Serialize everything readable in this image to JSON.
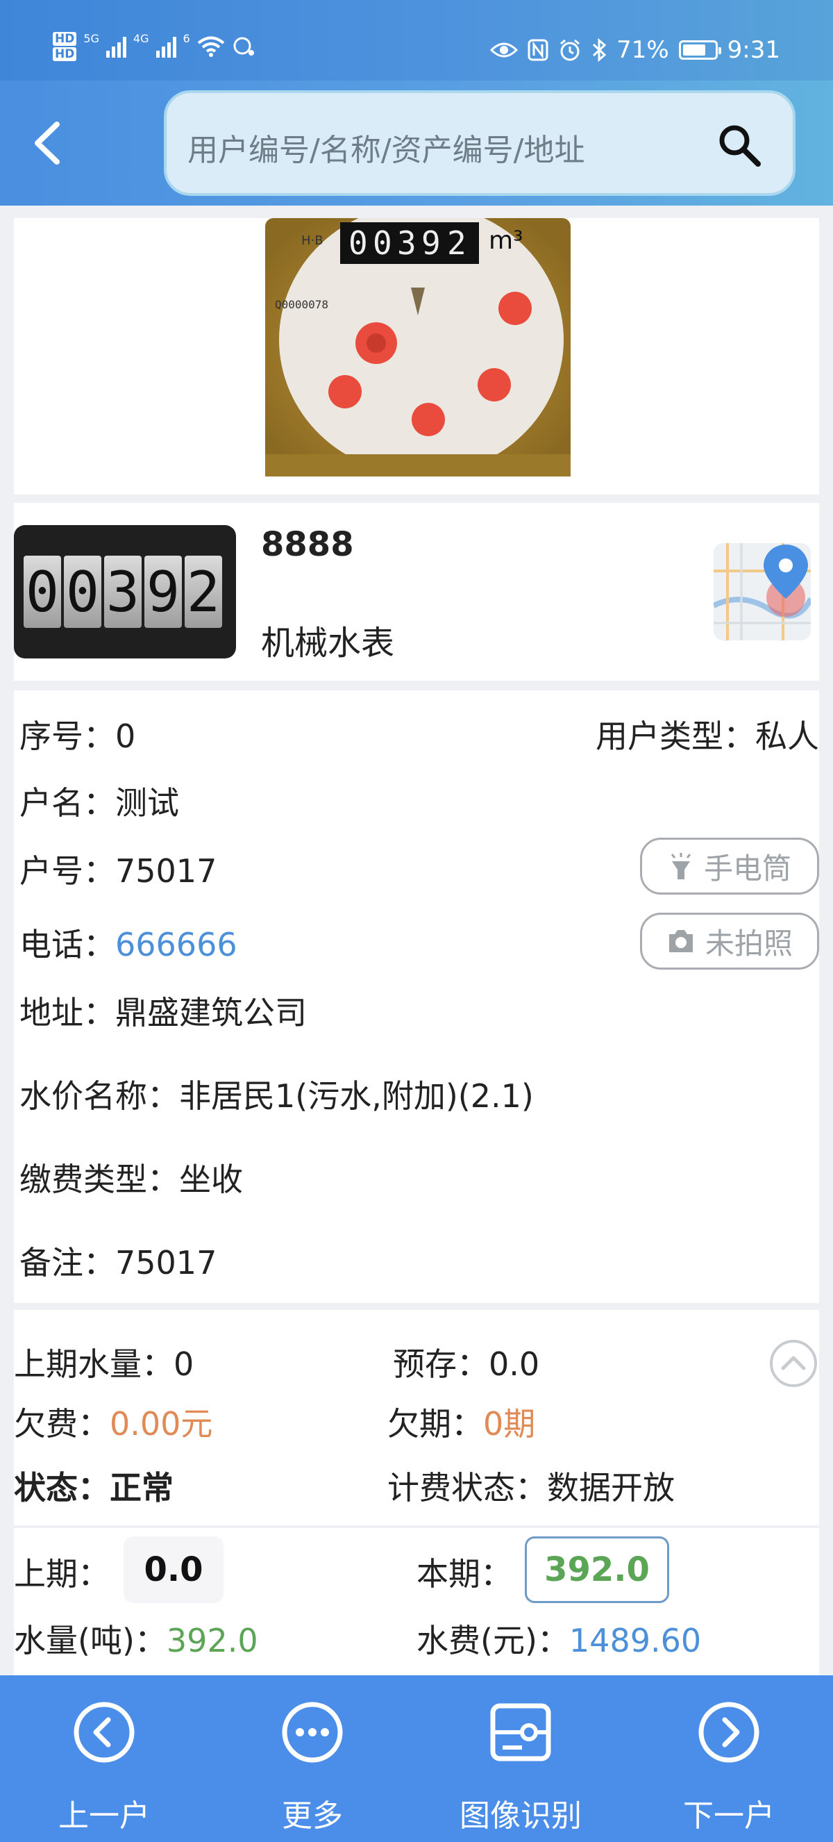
{
  "status_bar": {
    "hd1": "HD",
    "hd2": "HD",
    "net1": "5G",
    "net2": "4G",
    "net3": "6",
    "battery": "71%",
    "time": "9:31"
  },
  "header": {
    "search_placeholder": "用户编号/名称/资产编号/地址"
  },
  "meter": {
    "number": "8888",
    "type": "机械水表",
    "digits": [
      "0",
      "0",
      "3",
      "9",
      "2"
    ]
  },
  "detail": {
    "seq_label": "序号：",
    "seq_value": "0",
    "user_type_label": "用户类型：",
    "user_type_value": "私人",
    "name_label": "户名：",
    "name_value": "测试",
    "account_label": "户号：",
    "account_value": "75017",
    "flashlight": "手电筒",
    "phone_label": "电话：",
    "phone_value": "666666",
    "photo_status": "未拍照",
    "address_label": "地址：",
    "address_value": "鼎盛建筑公司",
    "price_label": "水价名称：",
    "price_value": "非居民1(污水,附加)(2.1)",
    "pay_label": "缴费类型：",
    "pay_value": "坐收",
    "remark_label": "备注：",
    "remark_value": "75017"
  },
  "stats": {
    "last_usage_label": "上期水量：",
    "last_usage_value": "0",
    "prestore_label": "预存：",
    "prestore_value": "0.0",
    "arrears_label": "欠费：",
    "arrears_value": "0.00元",
    "arrears_period_label": "欠期：",
    "arrears_period_value": "0期",
    "status_label": "状态：",
    "status_value": "正常",
    "billing_label": "计费状态：",
    "billing_value": "数据开放"
  },
  "reading": {
    "prev_label": "上期：",
    "prev_value": "0.0",
    "curr_label": "本期：",
    "curr_value": "392.0",
    "volume_label": "水量(吨)：",
    "volume_value": "392.0",
    "fee_label": "水费(元)：",
    "fee_value": "1489.60"
  },
  "nav": {
    "prev": "上一户",
    "more": "更多",
    "recognize": "图像识别",
    "next": "下一户"
  },
  "colors": {
    "accent_blue": "#4b90d9",
    "orange": "#e08a55",
    "green": "#5ca557",
    "nav_bg": "#4b8eea"
  }
}
